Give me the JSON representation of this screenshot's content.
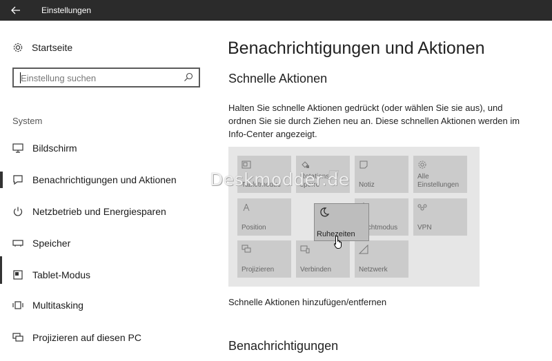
{
  "window": {
    "title": "Einstellungen"
  },
  "nav": {
    "home_label": "Startseite",
    "search_placeholder": "Einstellung suchen",
    "section_label": "System",
    "items": [
      {
        "label": "Bildschirm",
        "icon": "monitor-icon"
      },
      {
        "label": "Benachrichtigungen und Aktionen",
        "icon": "notification-icon",
        "active": true
      },
      {
        "label": "Netzbetrieb und Energiesparen",
        "icon": "power-icon"
      },
      {
        "label": "Speicher",
        "icon": "storage-icon"
      },
      {
        "label": "Tablet-Modus",
        "icon": "tablet-icon"
      },
      {
        "label": "Multitasking",
        "icon": "multitasking-icon"
      },
      {
        "label": "Projizieren auf diesen PC",
        "icon": "project-icon"
      }
    ]
  },
  "main": {
    "title": "Benachrichtigungen und Aktionen",
    "quick_actions_title": "Schnelle Aktionen",
    "description": "Halten Sie schnelle Aktionen gedrückt (oder wählen Sie sie aus), und ordnen Sie sie durch Ziehen neu an. Diese schnellen Aktionen werden im Info-Center angezeigt.",
    "tiles": [
      {
        "label": "Tabletmodus",
        "icon": "tablet-mode-icon"
      },
      {
        "label": "Rotations-\nsperre",
        "icon": "rotation-lock-icon"
      },
      {
        "label": "Notiz",
        "icon": "note-icon"
      },
      {
        "label": "Alle\nEinstellungen",
        "icon": "gear-icon"
      },
      {
        "label": "Position",
        "icon": "location-icon"
      },
      {
        "label": "",
        "icon": ""
      },
      {
        "label": "Nachtmodus",
        "icon": "brightness-icon"
      },
      {
        "label": "VPN",
        "icon": "vpn-icon"
      },
      {
        "label": "Projizieren",
        "icon": "project-icon"
      },
      {
        "label": "Verbinden",
        "icon": "connect-icon"
      },
      {
        "label": "Netzwerk",
        "icon": "network-icon"
      }
    ],
    "dragged_tile": {
      "label": "Ruhezeiten",
      "icon": "moon-icon"
    },
    "watermark": "Deskmodder.de",
    "add_remove_link": "Schnelle Aktionen hinzufügen/entfernen",
    "notifications_title": "Benachrichtigungen"
  }
}
